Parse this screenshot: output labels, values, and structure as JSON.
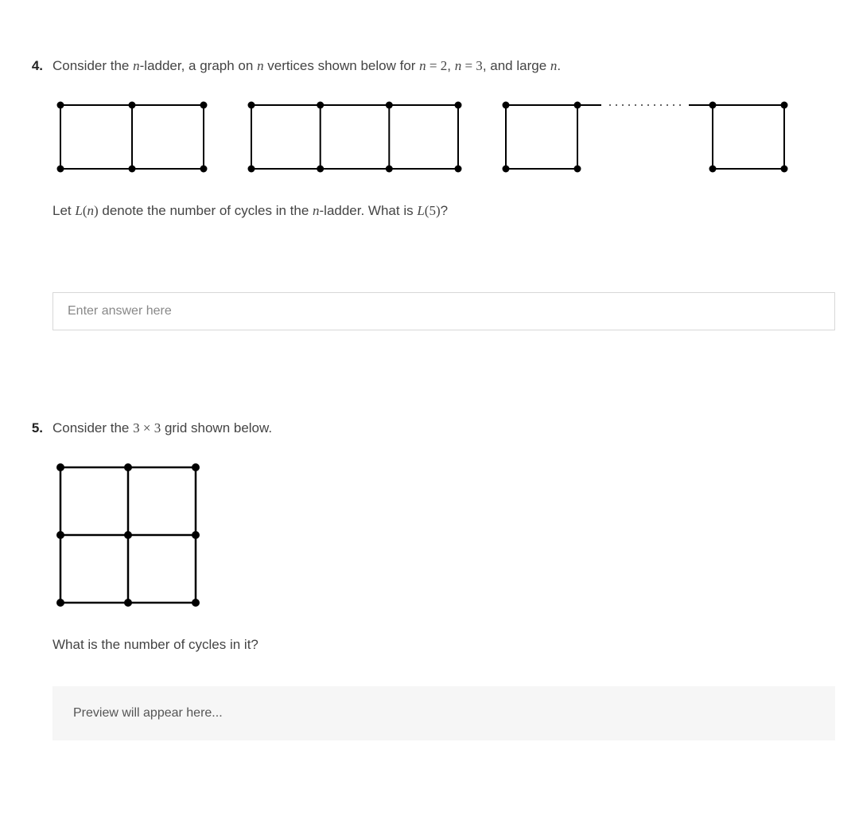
{
  "q4": {
    "number": "4.",
    "prompt_pre": "Consider the ",
    "prompt_var1": "n",
    "prompt_mid1": "-ladder, a graph on ",
    "prompt_var2": "n",
    "prompt_mid2": " vertices shown below for ",
    "prompt_eq1": "n = 2",
    "prompt_comma": ", ",
    "prompt_eq2": "n = 3",
    "prompt_mid3": ", and large ",
    "prompt_var3": "n",
    "prompt_end": ".",
    "sub_pre": "Let ",
    "sub_L": "L(n)",
    "sub_mid1": " denote the number of cycles in the ",
    "sub_var": "n",
    "sub_mid2": "-ladder. What is ",
    "sub_L5": "L(5)",
    "sub_end": "?",
    "answer_placeholder": "Enter answer here"
  },
  "q5": {
    "number": "5.",
    "prompt_pre": "Consider the ",
    "prompt_dim": "3 × 3",
    "prompt_post": " grid shown below.",
    "subprompt": "What is the number of cycles in it?",
    "preview_text": "Preview will appear here..."
  }
}
